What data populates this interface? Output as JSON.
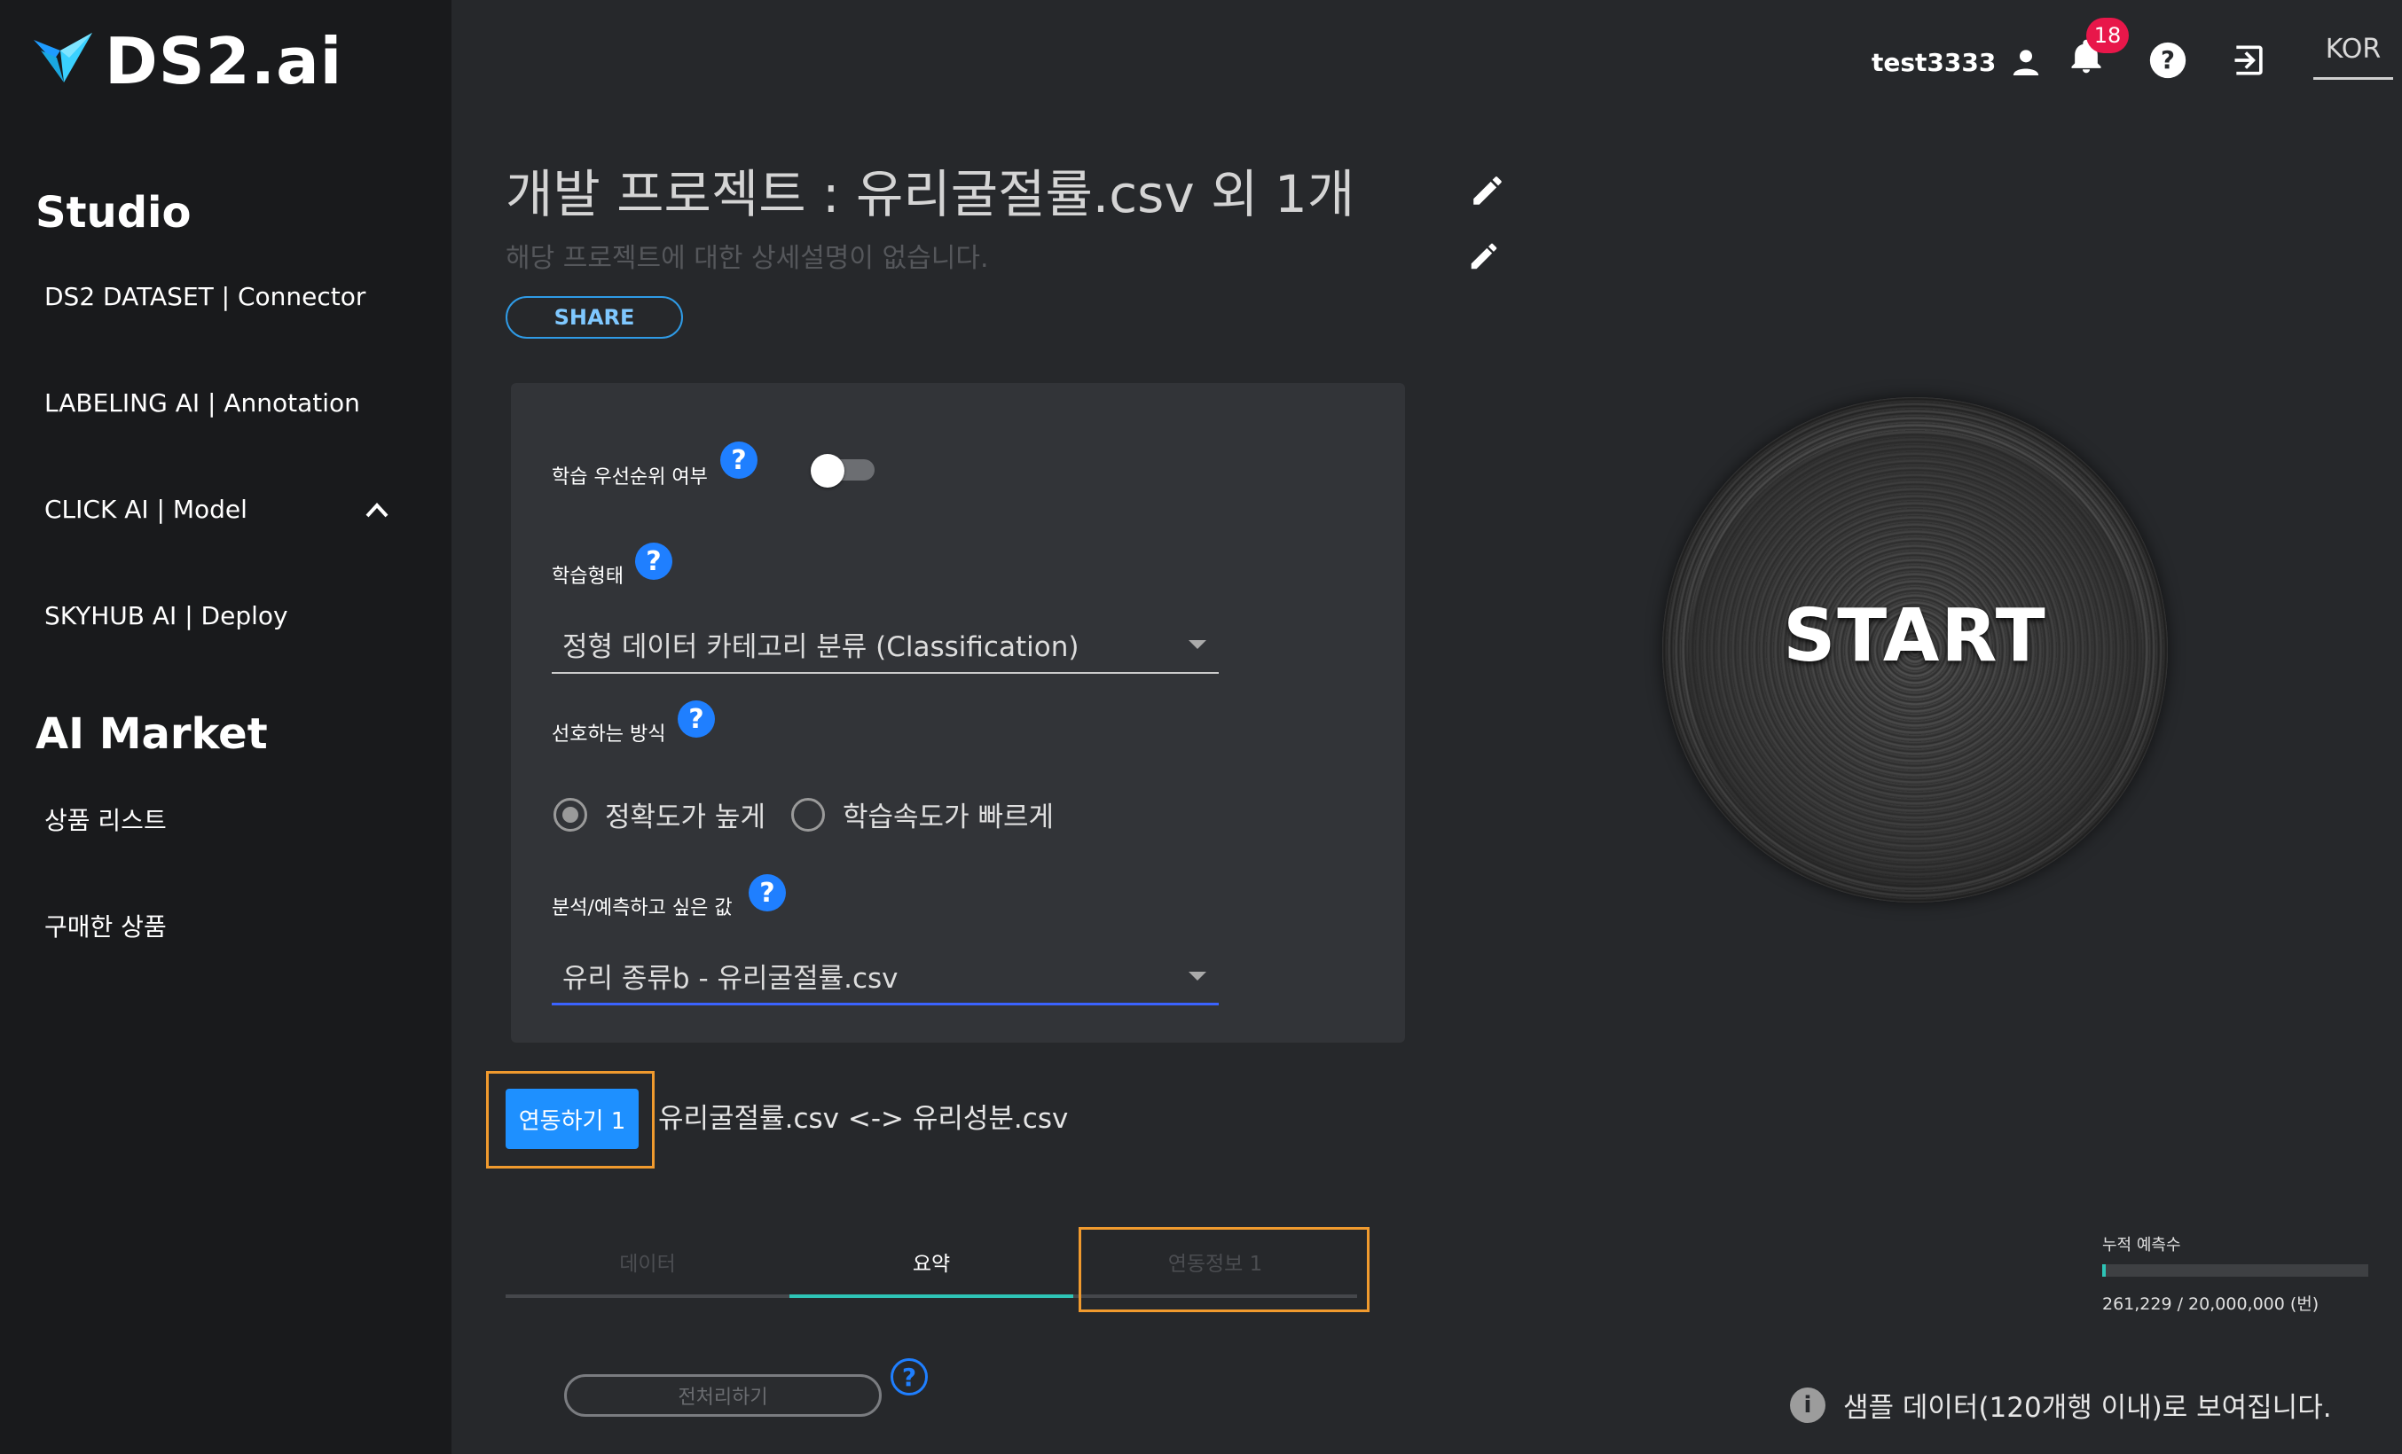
{
  "sidebar": {
    "logo_text": "DS2.ai",
    "sections": [
      {
        "title": "Studio"
      },
      {
        "title": "AI Market"
      }
    ],
    "items": [
      {
        "label": "DS2 DATASET | Connector"
      },
      {
        "label": "LABELING AI | Annotation"
      },
      {
        "label": "CLICK AI | Model"
      },
      {
        "label": "SKYHUB AI | Deploy"
      },
      {
        "label": "상품 리스트"
      },
      {
        "label": "구매한 상품"
      }
    ]
  },
  "header": {
    "username": "test3333",
    "notification_count": "18",
    "language": "KOR"
  },
  "project": {
    "title": "개발 프로젝트 : 유리굴절률.csv 외 1개",
    "description": "해당 프로젝트에 대한 상세설명이 없습니다.",
    "share_label": "SHARE"
  },
  "settings": {
    "priority_label": "학습 우선순위 여부",
    "priority_enabled": false,
    "type_label": "학습형태",
    "type_value": "정형 데이터 카테고리 분류 (Classification)",
    "method_label": "선호하는 방식",
    "method_options": [
      "정확도가 높게",
      "학습속도가 빠르게"
    ],
    "method_selected": "정확도가 높게",
    "target_label": "분석/예측하고 싶은 값",
    "target_value": "유리 종류b - 유리굴절률.csv"
  },
  "link": {
    "button_label": "연동하기 1",
    "description": "유리굴절률.csv <-> 유리성분.csv"
  },
  "tabs": [
    {
      "label": "데이터"
    },
    {
      "label": "요약"
    },
    {
      "label": "연동정보 1"
    }
  ],
  "active_tab": "요약",
  "preprocess_label": "전처리하기",
  "start_label": "START",
  "prediction": {
    "title": "누적 예측수",
    "count_text": "261,229 / 20,000,000 (번)",
    "used": 261229,
    "limit": 20000000
  },
  "sample_note": "샘플 데이터(120개행 이내)로 보여집니다.",
  "colors": {
    "background": "#26282b",
    "sidebar": "#191a1c",
    "accent": "#1e90ff",
    "teal": "#2ec4b6",
    "badge": "#e8174a",
    "highlight": "#f09a2e"
  }
}
